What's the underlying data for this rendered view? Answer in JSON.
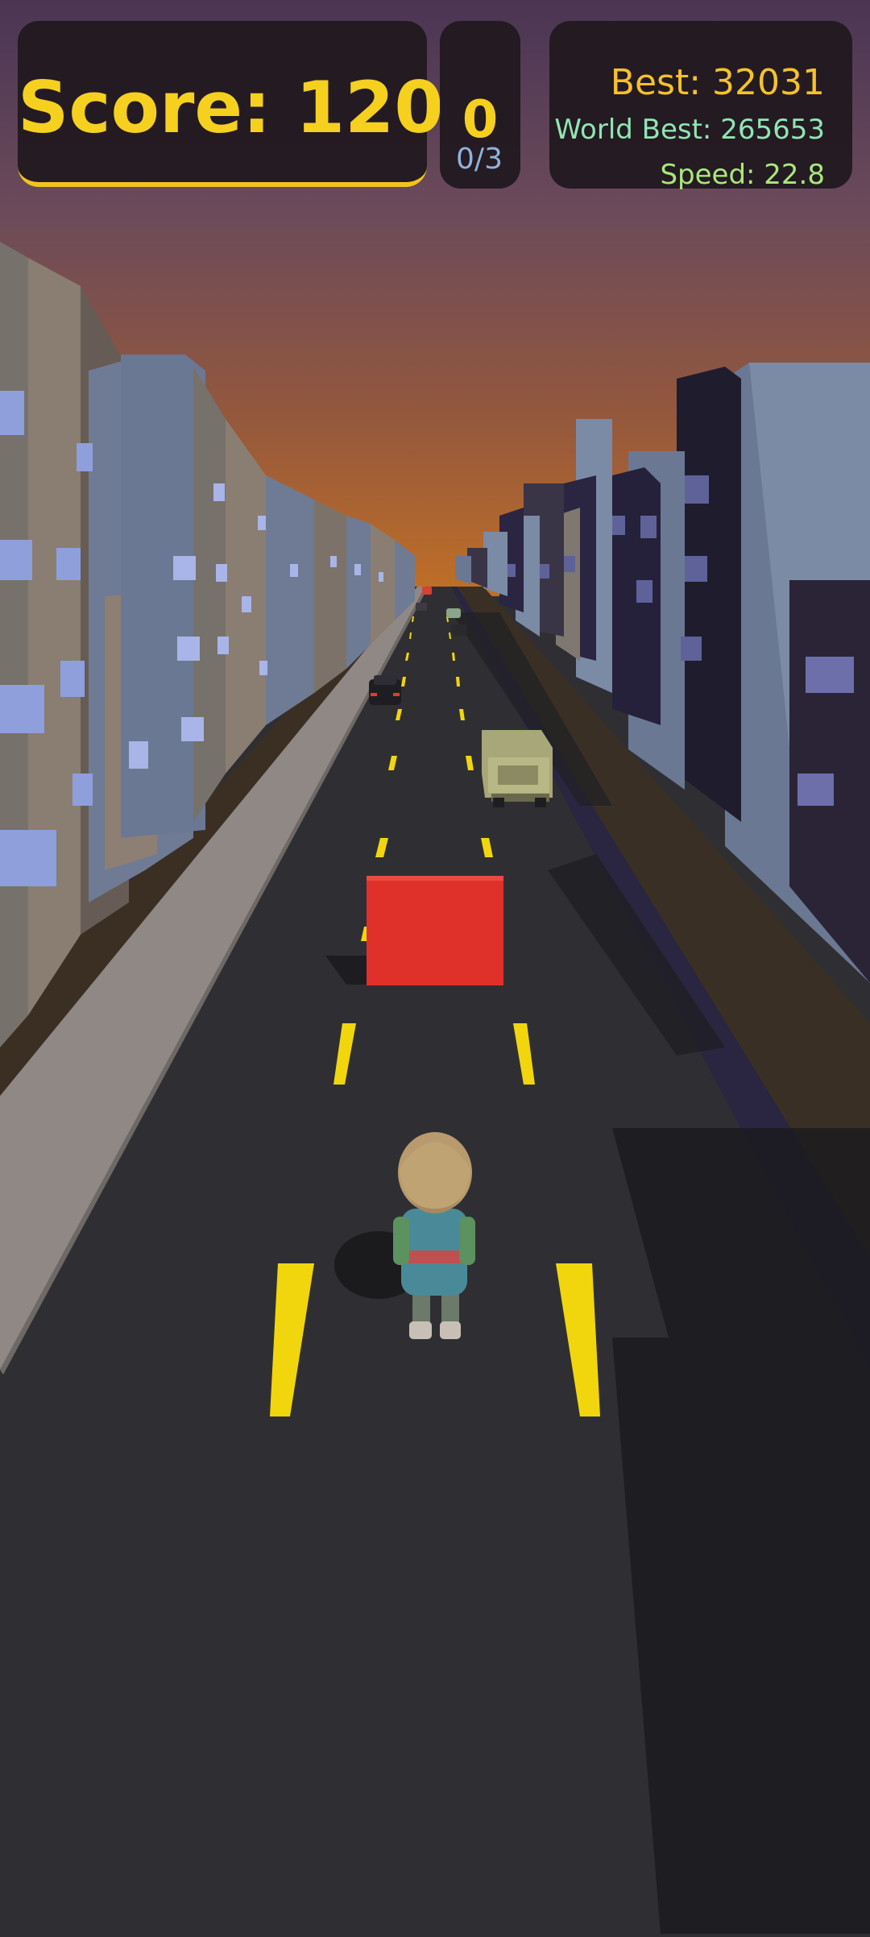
{
  "hud": {
    "score_text": "Score: 120",
    "coins": "0",
    "coin_progress": "0/3",
    "best_text": "Best: 32031",
    "world_best_text": "World Best: 265653",
    "speed_text": "Speed: 22.8"
  },
  "colors": {
    "hud_accent": "#f5d01f",
    "sky_top": "#4a3554",
    "sky_horizon": "#b4692a",
    "road": "#2f2f33",
    "lane_marking": "#f1d60e",
    "obstacle_block": "#e0302a",
    "sidewalk": "#8f8885"
  }
}
